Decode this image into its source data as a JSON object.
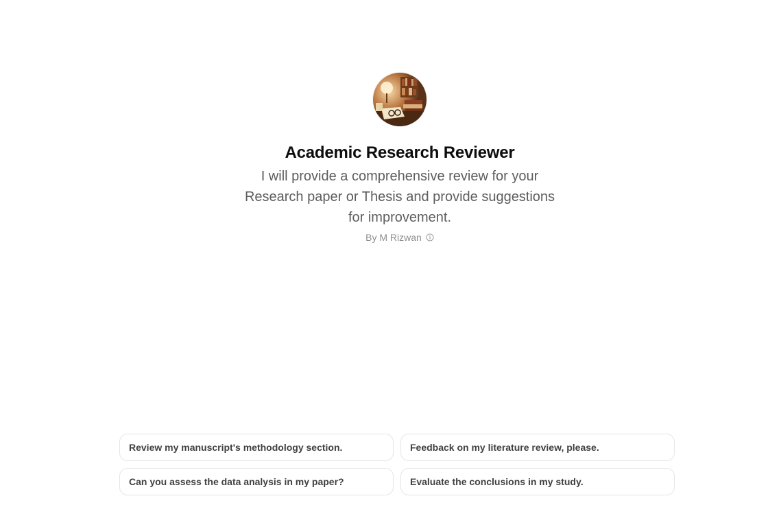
{
  "gpt": {
    "name": "Academic Research Reviewer",
    "description": "I will provide a comprehensive review for your Research paper or Thesis and provide suggestions for improvement.",
    "author": "By M Rizwan"
  },
  "suggestions": [
    "Review my manuscript's methodology section.",
    "Feedback on my literature review, please.",
    "Can you assess the data analysis in my paper?",
    "Evaluate the conclusions in my study."
  ]
}
